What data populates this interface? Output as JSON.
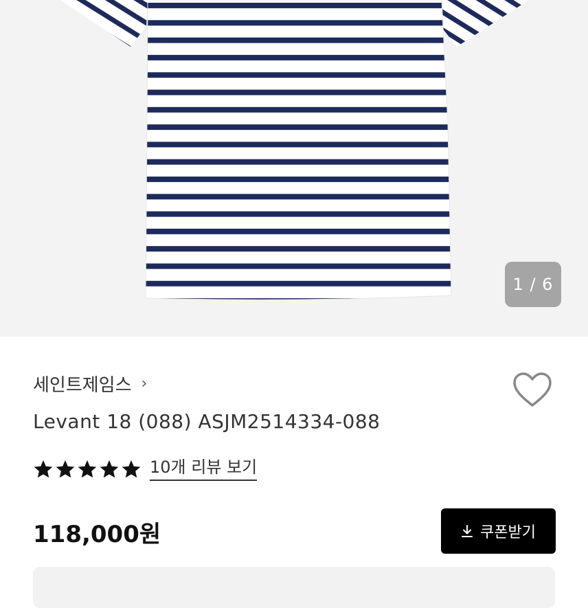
{
  "gallery": {
    "counter": "1 / 6",
    "stripe_color": "#1d2a5b"
  },
  "product": {
    "brand": "세인트제임스",
    "brand_chevron": "›",
    "name": "Levant 18 (088) ASJM2514334-088",
    "rating": 5,
    "review_link": "10개 리뷰 보기",
    "price": "118,000원"
  },
  "actions": {
    "coupon_label": "쿠폰받기",
    "coupon_icon": "download-icon",
    "wishlist_icon": "heart-icon"
  }
}
